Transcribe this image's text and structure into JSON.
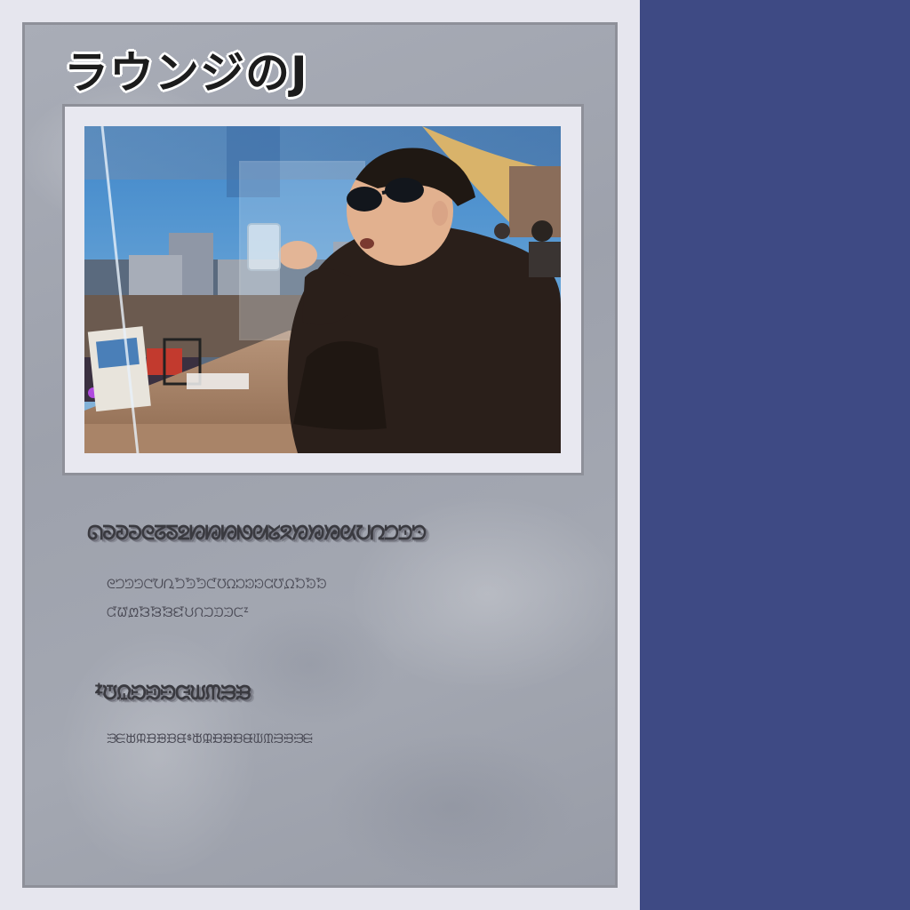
{
  "card": {
    "title": "ラウンジのJ",
    "heading_1": "ᘏᘐᘑᘒᘓᘔᘕᘖᘗᘘᘙᘚᘛᘜᘝᘞᘟᘠᘡᘢᘣᘤᘥᘦ",
    "body_1a": "ᘓᘤᘥᘦᘧᘨᘩᘪᘫᘬᘭᘮᘯᘰᘱᘲᘳᘴᘵᘶᘷᘸ",
    "body_1b": "ᘹᘺᘻᘼᘽᘾᘿᙀᙁᙂᙃᙄᙅᙆ",
    "heading_2": "ᙇᙈᙉᙊᙋᙌᙍᙎᙏᙐᙑ",
    "body_2a": "ᙒᙓᙔᙕᙖᙗᙘᙙᙚᙛᙜᙝᙞᙟᙠᙡᙢᙣᙤᙥᙦ"
  },
  "colors": {
    "side_panel": "#3e4a84",
    "background": "#e6e6ee",
    "card_border": "#8e9099"
  }
}
